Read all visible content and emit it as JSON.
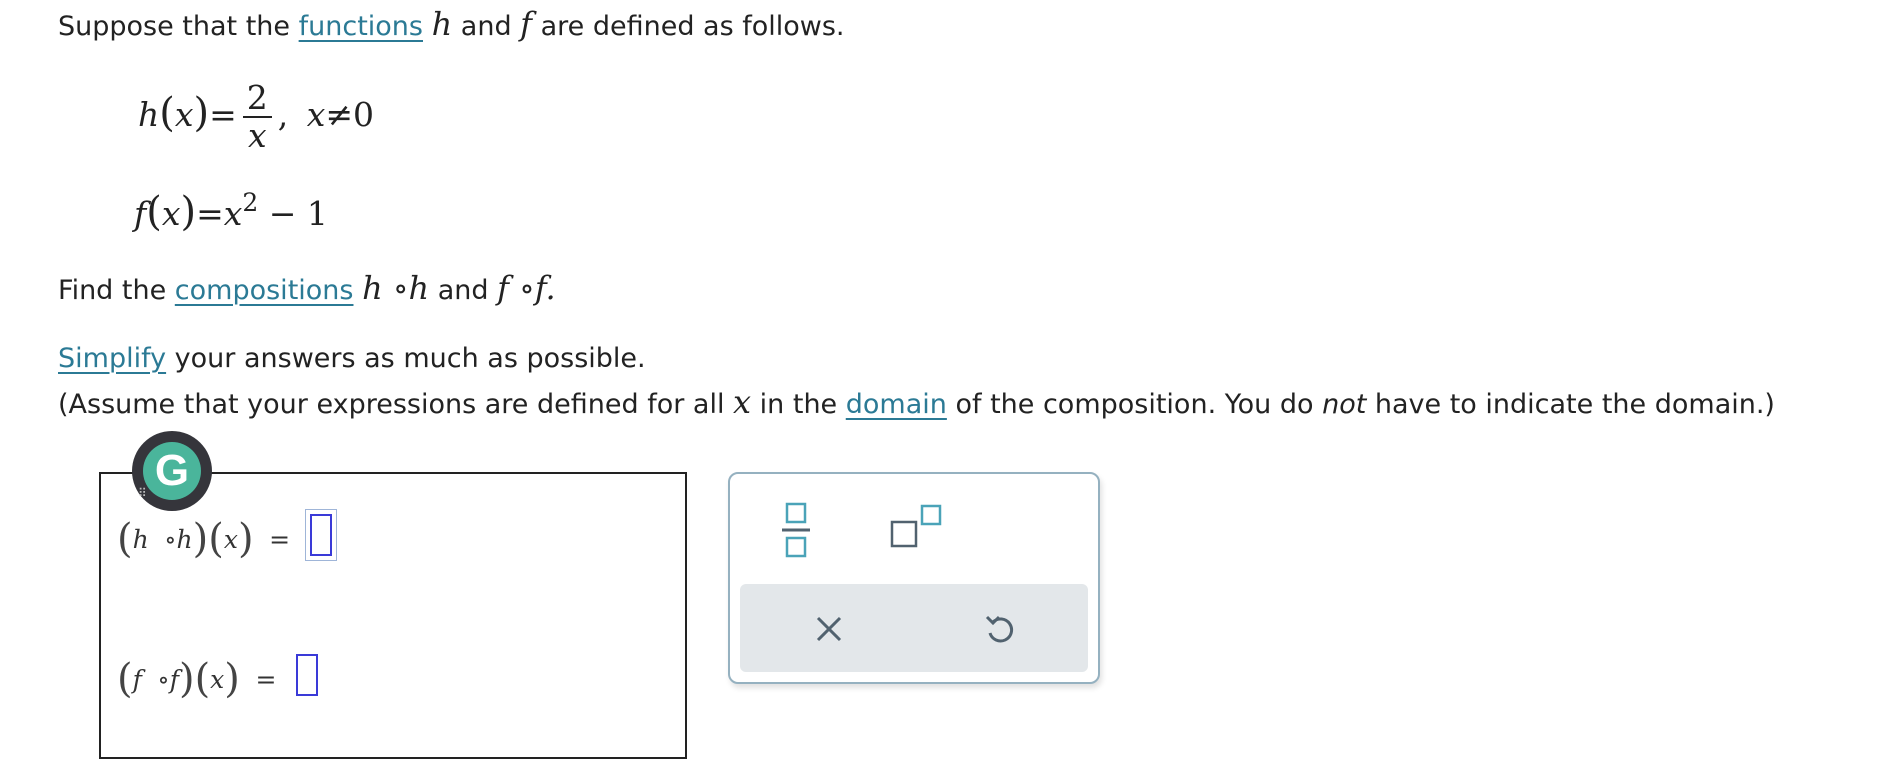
{
  "intro": {
    "prefix": "Suppose that the ",
    "link_functions": "functions",
    "var_h": "h",
    "and": " and ",
    "var_f": "f",
    "suffix": " are defined as follows."
  },
  "defs": {
    "h_lhs": "h",
    "x": "x",
    "equals": "=",
    "h_num": "2",
    "h_den": "x",
    "comma": ",",
    "h_cond_x": "x",
    "h_cond_ne": "≠",
    "h_cond_val": "0",
    "f_lhs": "f",
    "f_exp": "2",
    "f_rest": " − 1"
  },
  "find": {
    "prefix": "Find the ",
    "link_compositions": "compositions",
    "comp1": "h ∘h",
    "and": " and ",
    "comp2": "f ∘f."
  },
  "simplify": {
    "link_simplify": "Simplify",
    "rest": " your answers as much as possible."
  },
  "assume": {
    "prefix": "(Assume that your expressions are defined for all ",
    "var_x": "x",
    "middle": " in the ",
    "link_domain": "domain",
    "middle2": " of the composition. You do ",
    "emph": "not",
    "suffix": " have to indicate the domain.)"
  },
  "answers": {
    "row1": {
      "f1": "h",
      "op": "∘",
      "f2": "h",
      "x": "x",
      "equals": "="
    },
    "row2": {
      "f1": "f",
      "op": "∘",
      "f2": "f",
      "x": "x",
      "equals": "="
    }
  },
  "grammarly": {
    "letter": "G"
  },
  "palette": {
    "fraction_icon": "fraction-icon",
    "superscript_icon": "superscript-icon",
    "clear_icon": "close-icon",
    "undo_icon": "undo-icon",
    "accent_color": "#4aa3b8",
    "icon_color": "#51626f"
  }
}
